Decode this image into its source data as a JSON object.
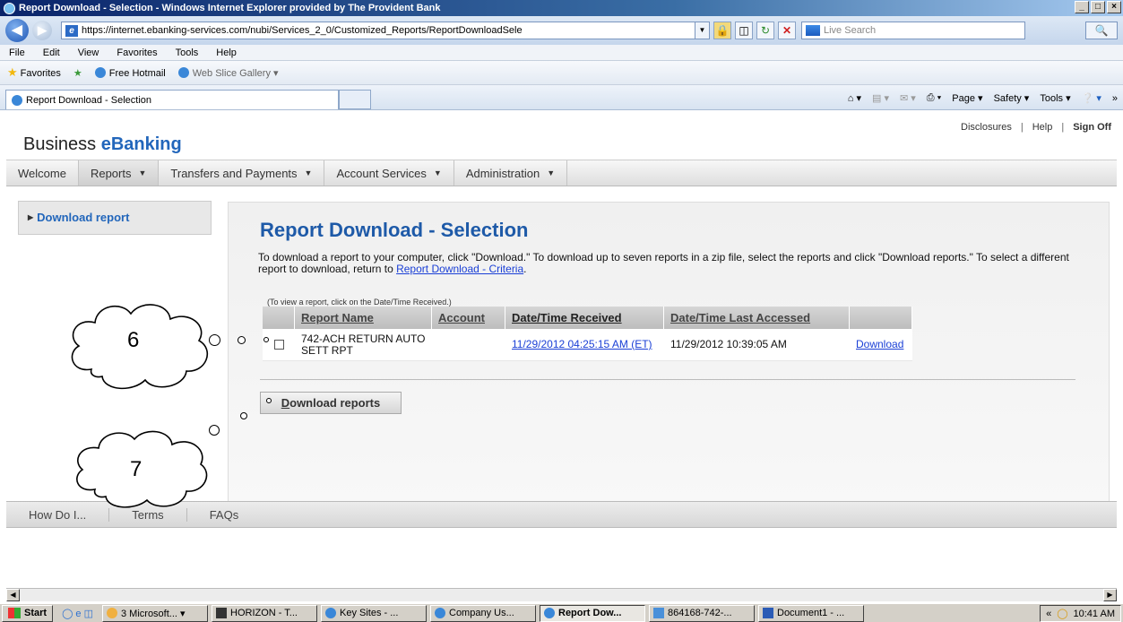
{
  "window": {
    "title": "Report Download - Selection - Windows Internet Explorer provided by The Provident Bank",
    "buttons": [
      "_",
      "□",
      "×"
    ]
  },
  "address": {
    "url": "https://internet.ebanking-services.com/nubi/Services_2_0/Customized_Reports/ReportDownloadSele",
    "search_placeholder": "Live Search"
  },
  "menu": [
    "File",
    "Edit",
    "View",
    "Favorites",
    "Tools",
    "Help"
  ],
  "favorites": {
    "favorites_label": "Favorites",
    "links": [
      "Free Hotmail",
      "Web Slice Gallery ▾"
    ]
  },
  "browser_tab": {
    "label": "Report Download - Selection"
  },
  "command_bar": [
    "Page ▾",
    "Safety ▾",
    "Tools ▾"
  ],
  "page": {
    "brand_prefix": "Business ",
    "brand_suffix": "eBanking",
    "top_links": [
      "Disclosures",
      "Help",
      "Sign Off"
    ],
    "nav": [
      {
        "label": "Welcome",
        "caret": ""
      },
      {
        "label": "Reports",
        "caret": "▼"
      },
      {
        "label": "Transfers and Payments",
        "caret": "▼"
      },
      {
        "label": "Account Services",
        "caret": "▼"
      },
      {
        "label": "Administration",
        "caret": "▼"
      }
    ],
    "side_link": "Download report",
    "heading": "Report Download - Selection",
    "intro_text": "To download a report to your computer, click \"Download.\" To download up to seven reports in a zip file, select the reports and click \"Download reports.\" To select a different report to download, return to ",
    "intro_link": "Report Download - Criteria",
    "intro_end": ".",
    "hint": "(To view a report, click on the Date/Time Received.)",
    "table": {
      "headers": [
        "",
        "Report Name",
        "Account",
        "Date/Time Received",
        "Date/Time Last Accessed",
        ""
      ],
      "rows": [
        {
          "report_name": "742-ACH RETURN AUTO SETT RPT",
          "account": "",
          "received": "11/29/2012 04:25:15 AM (ET)",
          "last_accessed": "11/29/2012 10:39:05 AM",
          "action": "Download"
        }
      ]
    },
    "download_button": {
      "prefix": "D",
      "rest": "ownload reports"
    },
    "footer": [
      "How Do I...",
      "Terms",
      "FAQs"
    ]
  },
  "annotations": {
    "cloud_6": "6",
    "cloud_7": "7"
  },
  "taskbar": {
    "start": "Start",
    "items": [
      {
        "label": "3 Microsoft... ▾",
        "pressed": false
      },
      {
        "label": "HORIZON - T...",
        "pressed": false
      },
      {
        "label": "Key Sites - ...",
        "pressed": false
      },
      {
        "label": "Company Us...",
        "pressed": false
      },
      {
        "label": "Report Dow...",
        "pressed": true
      },
      {
        "label": "864168-742-...",
        "pressed": false
      },
      {
        "label": "Document1 - ...",
        "pressed": false
      }
    ],
    "clock": "10:41 AM"
  }
}
